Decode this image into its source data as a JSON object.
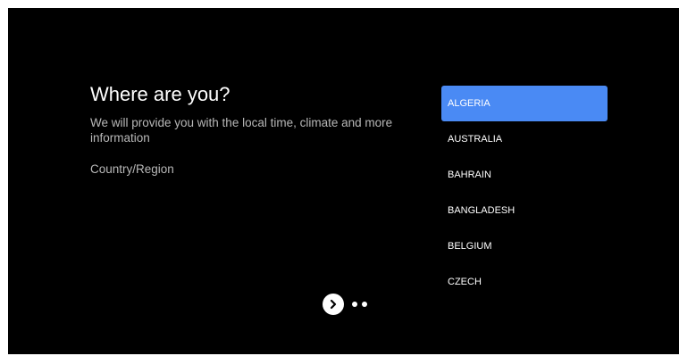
{
  "screen": {
    "title": "Where are you?",
    "subtitle": "We will provide you with the local time, climate and more information",
    "field_label": "Country/Region"
  },
  "country_list": {
    "selected_index": 0,
    "items": [
      {
        "label": "ALGERIA"
      },
      {
        "label": "AUSTRALIA"
      },
      {
        "label": "BAHRAIN"
      },
      {
        "label": "BANGLADESH"
      },
      {
        "label": "BELGIUM"
      },
      {
        "label": "CZECH"
      }
    ]
  },
  "pager": {
    "next_icon": "chevron-right-icon",
    "total_steps": 3
  },
  "colors": {
    "background": "#000000",
    "accent": "#4a8af4",
    "secondary_text": "#b8b8b8"
  }
}
